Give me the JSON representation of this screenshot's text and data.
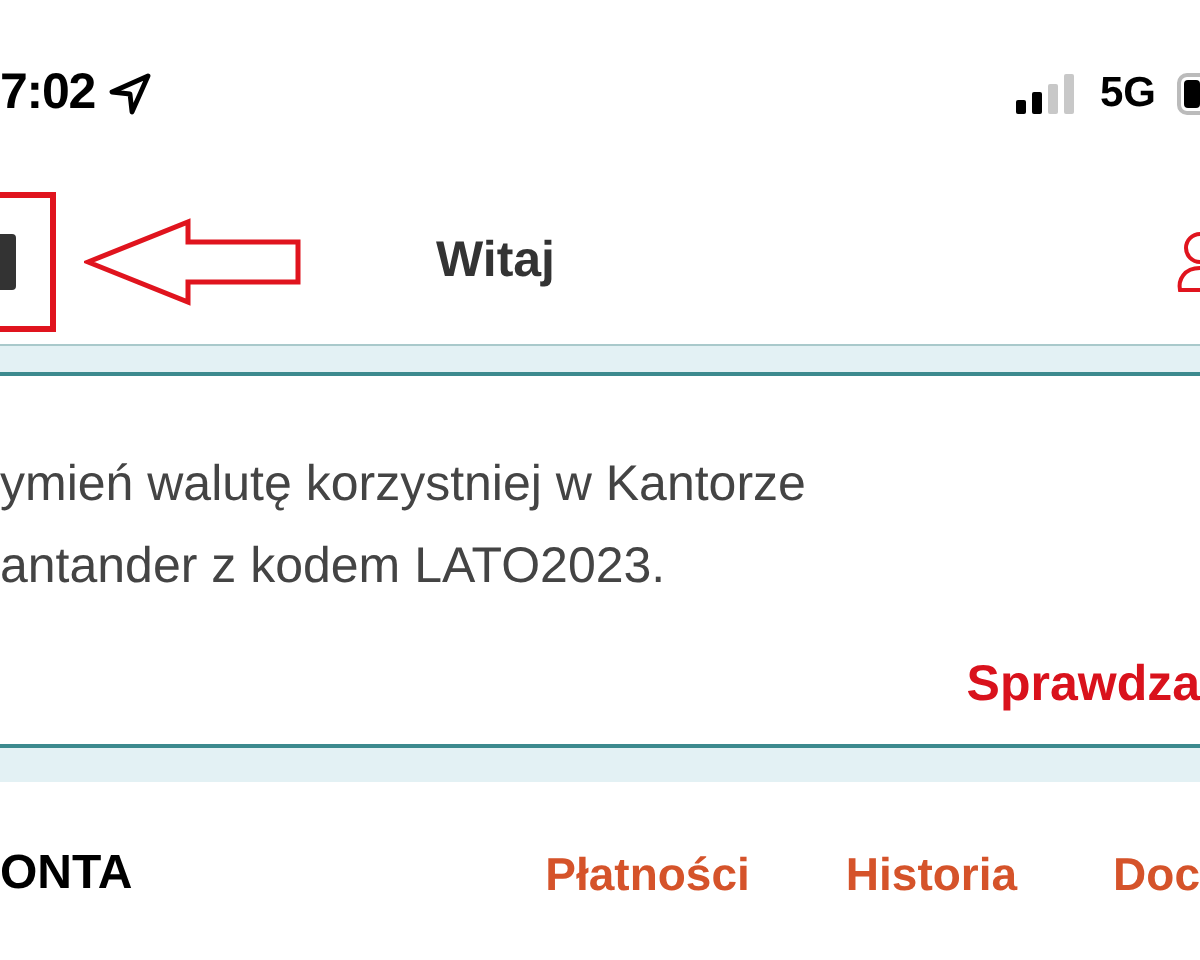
{
  "status_bar": {
    "time": "7:02",
    "network": "5G"
  },
  "header": {
    "title": "Witaj"
  },
  "promo": {
    "lines": [
      "ymień walutę korzystniej w Kantorze",
      "antander z kodem LATO2023."
    ],
    "action": "Sprawdza"
  },
  "accounts": {
    "heading": "ONTA",
    "tabs": [
      {
        "label": "Płatności"
      },
      {
        "label": "Historia"
      },
      {
        "label": "Doc"
      }
    ]
  }
}
